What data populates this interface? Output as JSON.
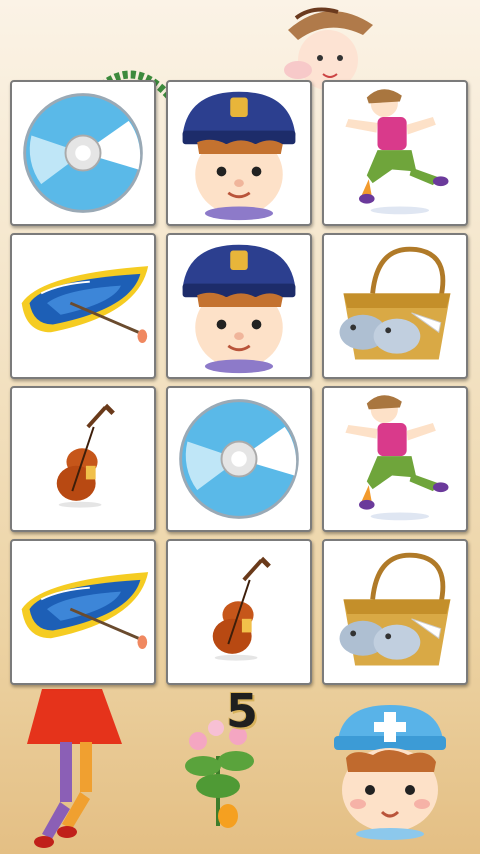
{
  "game": {
    "moves_left": "5",
    "cards": [
      {
        "item": "cd-disc"
      },
      {
        "item": "police-boy"
      },
      {
        "item": "running-boy"
      },
      {
        "item": "raft-boat"
      },
      {
        "item": "police-boy"
      },
      {
        "item": "fish-basket"
      },
      {
        "item": "violin"
      },
      {
        "item": "cd-disc"
      },
      {
        "item": "running-boy"
      },
      {
        "item": "raft-boat"
      },
      {
        "item": "violin"
      },
      {
        "item": "fish-basket"
      }
    ]
  },
  "decorations": [
    "girl-with-hat",
    "dancing-girl",
    "flower-plant",
    "nurse-boy"
  ]
}
